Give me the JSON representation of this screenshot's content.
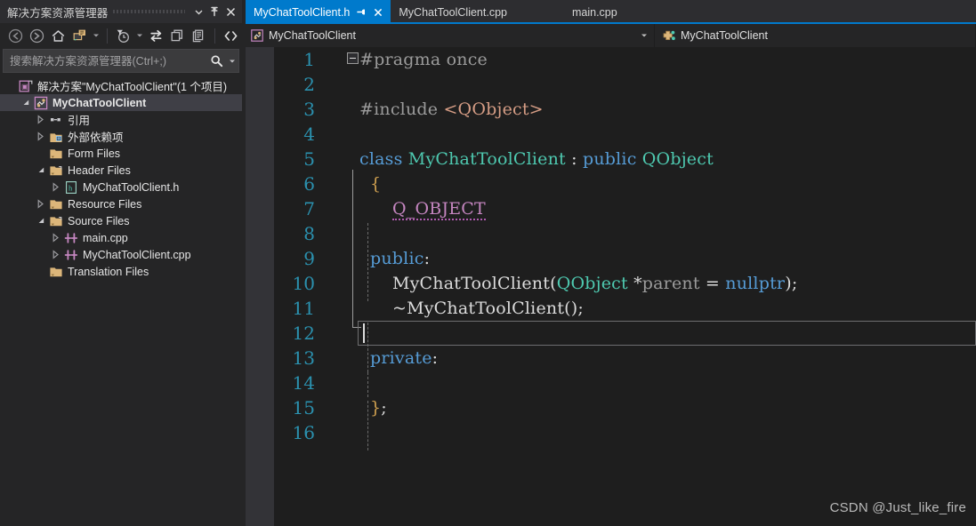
{
  "solution_explorer": {
    "title": "解决方案资源管理器",
    "titlebar_buttons": [
      {
        "name": "dropdown-icon",
        "label": "▼"
      },
      {
        "name": "pin-icon",
        "label": "Pin"
      },
      {
        "name": "close-icon",
        "label": "✕"
      }
    ],
    "toolbar": [
      {
        "name": "back-icon",
        "tooltip": "后退"
      },
      {
        "name": "forward-icon",
        "tooltip": "前进"
      },
      {
        "name": "home-icon",
        "tooltip": "主页"
      },
      {
        "name": "properties-folder-icon",
        "tooltip": "属性"
      },
      {
        "name": "properties-dropdown-icon",
        "tooltip": "▾"
      },
      {
        "name": "pending-changes-icon",
        "tooltip": "挂起的更改筛选器"
      },
      {
        "name": "pending-changes-dropdown-icon",
        "tooltip": "▾"
      },
      {
        "name": "sync-with-active-document-icon",
        "tooltip": "与活动文档同步"
      },
      {
        "name": "refresh-icon",
        "tooltip": "刷新"
      },
      {
        "name": "show-all-files-icon",
        "tooltip": "显示所有文件"
      },
      {
        "name": "view-code-icon",
        "tooltip": "查看代码"
      }
    ],
    "search": {
      "placeholder": "搜索解决方案资源管理器(Ctrl+;)",
      "value": ""
    },
    "tree": [
      {
        "label": "解决方案\"MyChatToolClient\"(1 个项目)",
        "indent": 0,
        "twisty": "none",
        "icon": "solution-icon",
        "selected": false,
        "bold": false
      },
      {
        "label": "MyChatToolClient",
        "indent": 1,
        "twisty": "expanded",
        "icon": "project-icon",
        "selected": true,
        "bold": true
      },
      {
        "label": "引用",
        "indent": 2,
        "twisty": "collapsed",
        "icon": "references-icon",
        "selected": false,
        "bold": false
      },
      {
        "label": "外部依赖项",
        "indent": 2,
        "twisty": "collapsed",
        "icon": "ext-deps-icon",
        "selected": false,
        "bold": false
      },
      {
        "label": "Form Files",
        "indent": 2,
        "twisty": "none",
        "icon": "folder-icon",
        "selected": false,
        "bold": false
      },
      {
        "label": "Header Files",
        "indent": 2,
        "twisty": "expanded",
        "icon": "folder-open-icon",
        "selected": false,
        "bold": false
      },
      {
        "label": "MyChatToolClient.h",
        "indent": 3,
        "twisty": "collapsed",
        "icon": "header-file-icon",
        "selected": false,
        "bold": false
      },
      {
        "label": "Resource Files",
        "indent": 2,
        "twisty": "collapsed",
        "icon": "folder-icon",
        "selected": false,
        "bold": false
      },
      {
        "label": "Source Files",
        "indent": 2,
        "twisty": "expanded",
        "icon": "folder-open-icon",
        "selected": false,
        "bold": false
      },
      {
        "label": "main.cpp",
        "indent": 3,
        "twisty": "collapsed",
        "icon": "cpp-file-icon",
        "selected": false,
        "bold": false
      },
      {
        "label": "MyChatToolClient.cpp",
        "indent": 3,
        "twisty": "collapsed",
        "icon": "cpp-file-icon",
        "selected": false,
        "bold": false
      },
      {
        "label": "Translation Files",
        "indent": 2,
        "twisty": "none",
        "icon": "folder-icon",
        "selected": false,
        "bold": false
      }
    ]
  },
  "tabs": [
    {
      "label": "MyChatToolClient.h",
      "active": true,
      "pinned": true,
      "closable": true
    },
    {
      "label": "MyChatToolClient.cpp",
      "active": false,
      "pinned": false,
      "closable": false
    },
    {
      "label": "main.cpp",
      "active": false,
      "pinned": false,
      "closable": false
    }
  ],
  "navigation_bar": {
    "left": {
      "label": "MyChatToolClient",
      "icon": "project-icon",
      "caret": "▾"
    },
    "right": {
      "label": "MyChatToolClient",
      "icon": "class-members-icon"
    }
  },
  "editor": {
    "current_line": 12,
    "first_line": 1,
    "last_line": 16,
    "lines": [
      {
        "n": 1,
        "indent": 0,
        "tokens": [
          {
            "t": "#pragma once",
            "c": "pp"
          }
        ]
      },
      {
        "n": 2,
        "indent": 0,
        "tokens": []
      },
      {
        "n": 3,
        "indent": 0,
        "tokens": [
          {
            "t": "#include ",
            "c": "pp"
          },
          {
            "t": "<QObject>",
            "c": "str"
          }
        ]
      },
      {
        "n": 4,
        "indent": 0,
        "tokens": []
      },
      {
        "n": 5,
        "indent": 0,
        "tokens": [
          {
            "t": "class ",
            "c": "kw"
          },
          {
            "t": "MyChatToolClient",
            "c": "ty"
          },
          {
            "t": " : ",
            "c": "punct"
          },
          {
            "t": "public ",
            "c": "kw"
          },
          {
            "t": "QObject",
            "c": "ty"
          }
        ]
      },
      {
        "n": 6,
        "indent": 1,
        "tokens": [
          {
            "t": "{",
            "c": "brace"
          }
        ]
      },
      {
        "n": 7,
        "indent": 2,
        "tokens": [
          {
            "t": "Q_OBJECT",
            "c": "macro sugg"
          }
        ]
      },
      {
        "n": 8,
        "indent": 1,
        "tokens": []
      },
      {
        "n": 9,
        "indent": 1,
        "tokens": [
          {
            "t": "public",
            "c": "kw"
          },
          {
            "t": ":",
            "c": "punct"
          }
        ]
      },
      {
        "n": 10,
        "indent": 2,
        "tokens": [
          {
            "t": "MyChatToolClient",
            "c": "id"
          },
          {
            "t": "(",
            "c": "punct"
          },
          {
            "t": "QObject",
            "c": "ty"
          },
          {
            "t": " *",
            "c": "punct"
          },
          {
            "t": "parent",
            "c": "prm"
          },
          {
            "t": " = ",
            "c": "punct"
          },
          {
            "t": "nullptr",
            "c": "kw"
          },
          {
            "t": ");",
            "c": "punct"
          }
        ]
      },
      {
        "n": 11,
        "indent": 2,
        "tokens": [
          {
            "t": "~MyChatToolClient();",
            "c": "id"
          }
        ]
      },
      {
        "n": 12,
        "indent": 1,
        "tokens": []
      },
      {
        "n": 13,
        "indent": 1,
        "tokens": [
          {
            "t": "private",
            "c": "kw"
          },
          {
            "t": ":",
            "c": "punct"
          }
        ]
      },
      {
        "n": 14,
        "indent": 1,
        "tokens": []
      },
      {
        "n": 15,
        "indent": 1,
        "tokens": [
          {
            "t": "}",
            "c": "brace"
          },
          {
            "t": ";",
            "c": "punct"
          }
        ]
      },
      {
        "n": 16,
        "indent": 0,
        "tokens": []
      }
    ]
  },
  "watermark": "CSDN @Just_like_fire",
  "colors": {
    "accent": "#007acc",
    "editor_bg": "#1e1e1e",
    "panel_bg": "#252526",
    "chrome_bg": "#2d2d30",
    "selection_bg": "#3f3f46",
    "gutter_bg": "#333337",
    "linenum": "#2b91af",
    "keyword": "#569cd6",
    "type": "#4ec9b0",
    "preprocessor": "#9b9b9b",
    "string": "#d69d85",
    "macro": "#c586c0",
    "text": "#dcdcdc",
    "folder": "#dcb67a"
  }
}
